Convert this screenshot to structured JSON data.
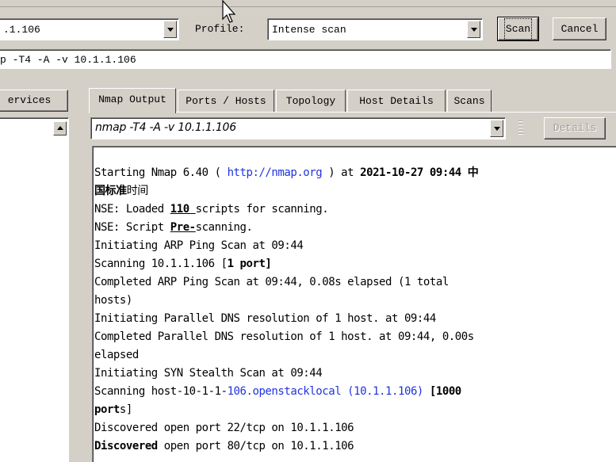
{
  "target": {
    "value": ".1.106"
  },
  "profile": {
    "label": "Profile:",
    "value": "Intense scan"
  },
  "buttons": {
    "scan": "Scan",
    "cancel": "Cancel",
    "services": "ervices",
    "details": "Details"
  },
  "command": "p -T4 -A -v 10.1.1.106",
  "tabs": [
    "Nmap Output",
    "Ports / Hosts",
    "Topology",
    "Host Details",
    "Scans"
  ],
  "output_selector": "nmap -T4 -A -v 10.1.1.106",
  "output": {
    "l1a": "Starting Nmap 6.40 ( ",
    "l1link": "http://nmap.org",
    "l1b": " ) at ",
    "l1date": "2021-10-27 09:44 中",
    "l2a": "国标准",
    "l2b": "时间",
    "l3a": "NSE: Loaded ",
    "l3b": "110 ",
    "l3c": "scripts for scanning.",
    "l4a": "NSE: Script ",
    "l4b": "Pre-",
    "l4c": "scanning.",
    "l5": "Initiating ARP Ping Scan at 09:44",
    "l6a": "Scanning 10.1.1.106 [",
    "l6b": "1 port]",
    "l7": "Completed ARP Ping Scan at 09:44, 0.08s elapsed (1 total",
    "l8": "hosts)",
    "l9": "Initiating Parallel DNS resolution of 1 host. at 09:44",
    "l10": "Completed Parallel DNS resolution of 1 host. at 09:44, 0.00s",
    "l11": "elapsed",
    "l12": "Initiating SYN Stealth Scan at 09:44",
    "l13a": "Scanning host-10-1-1-",
    "l13link": "106.openstacklocal (10.1.1.106)",
    "l13b": " [1000",
    "l14a": "port",
    "l14b": "s]",
    "l15": "Discovered open port 22/tcp on 10.1.1.106",
    "l16a": "Discovered",
    "l16b": " open port 80/tcp on 10.1.1.106"
  },
  "colors": {
    "link": "#1f33e0",
    "window": "#d4d0c8"
  }
}
